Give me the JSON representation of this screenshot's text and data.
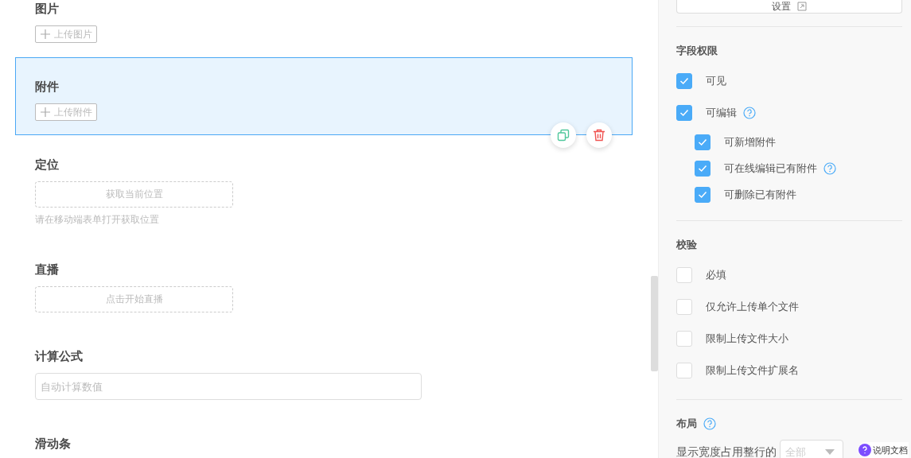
{
  "form_fields": [
    {
      "kind": "upload",
      "label": "图片",
      "button": "上传图片",
      "selected": false
    },
    {
      "kind": "upload",
      "label": "附件",
      "button": "上传附件",
      "selected": true
    },
    {
      "kind": "action",
      "label": "定位",
      "button": "获取当前位置",
      "hint": "请在移动端表单打开获取位置",
      "selected": false
    },
    {
      "kind": "action",
      "label": "直播",
      "button": "点击开始直播",
      "selected": false
    },
    {
      "kind": "input",
      "label": "计算公式",
      "placeholder": "自动计算数值",
      "selected": false
    },
    {
      "kind": "heading",
      "label": "滑动条",
      "selected": false
    }
  ],
  "settings_button": {
    "label": "设置"
  },
  "sections": [
    {
      "title": "字段权限",
      "help": false,
      "options": [
        {
          "label": "可见",
          "checked": true,
          "help": false
        },
        {
          "label": "可编辑",
          "checked": true,
          "help": true,
          "children": [
            {
              "label": "可新增附件",
              "checked": true,
              "help": false
            },
            {
              "label": "可在线编辑已有附件",
              "checked": true,
              "help": true
            },
            {
              "label": "可删除已有附件",
              "checked": true,
              "help": false
            }
          ]
        }
      ]
    },
    {
      "title": "校验",
      "help": false,
      "options": [
        {
          "label": "必填",
          "checked": false,
          "help": false
        },
        {
          "label": "仅允许上传单个文件",
          "checked": false,
          "help": false
        },
        {
          "label": "限制上传文件大小",
          "checked": false,
          "help": false
        },
        {
          "label": "限制上传文件扩展名",
          "checked": false,
          "help": false
        }
      ]
    },
    {
      "title": "布局",
      "help": true,
      "width_row": {
        "label": "显示宽度占用整行的",
        "select": "全部"
      }
    }
  ],
  "help_doc": {
    "label": "说明文档"
  }
}
